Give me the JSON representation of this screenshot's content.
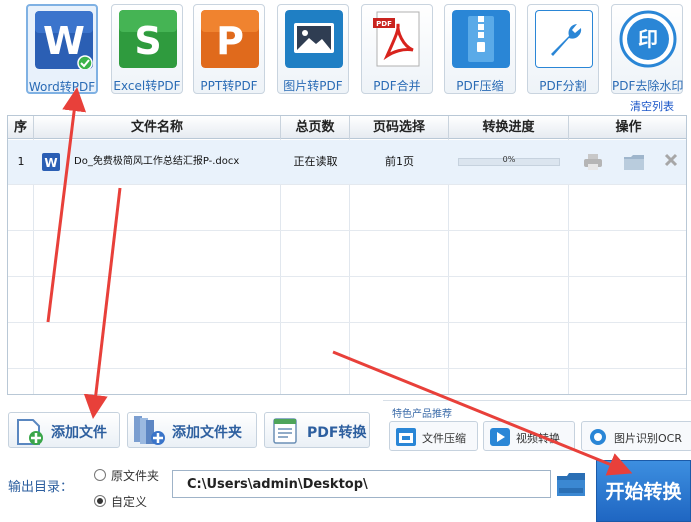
{
  "toolbar": {
    "items": [
      {
        "label": "Word转PDF"
      },
      {
        "label": "Excel转PDF"
      },
      {
        "label": "PPT转PDF"
      },
      {
        "label": "图片转PDF"
      },
      {
        "label": "PDF合并"
      },
      {
        "label": "PDF压缩"
      },
      {
        "label": "PDF分割"
      },
      {
        "label": "PDF去除水印"
      }
    ],
    "clear_list": "清空列表"
  },
  "table": {
    "columns": [
      "序",
      "文件名称",
      "总页数",
      "页码选择",
      "转换进度",
      "操作"
    ],
    "rows": [
      {
        "index": "1",
        "file_name": "Do_免费极简风工作总结汇报P-.docx",
        "pages": "正在读取",
        "page_select": "前1页",
        "progress": "0%",
        "progress_value": 0
      }
    ]
  },
  "buttons": {
    "add_file": "添加文件",
    "add_folder": "添加文件夹",
    "pdf_convert": "PDF转换"
  },
  "promo": {
    "title": "特色产品推荐",
    "items": [
      {
        "label": "文件压缩"
      },
      {
        "label": "视频转换"
      },
      {
        "label": "图片识别OCR"
      }
    ]
  },
  "output": {
    "label": "输出目录：",
    "option_source": "原文件夹",
    "option_custom": "自定义",
    "path": "C:\\Users\\admin\\Desktop\\"
  },
  "start_button": "开始转换",
  "colors": {
    "accent": "#2a6bb5",
    "start": "#1f66c2",
    "annotation_arrow": "#e8403a"
  }
}
